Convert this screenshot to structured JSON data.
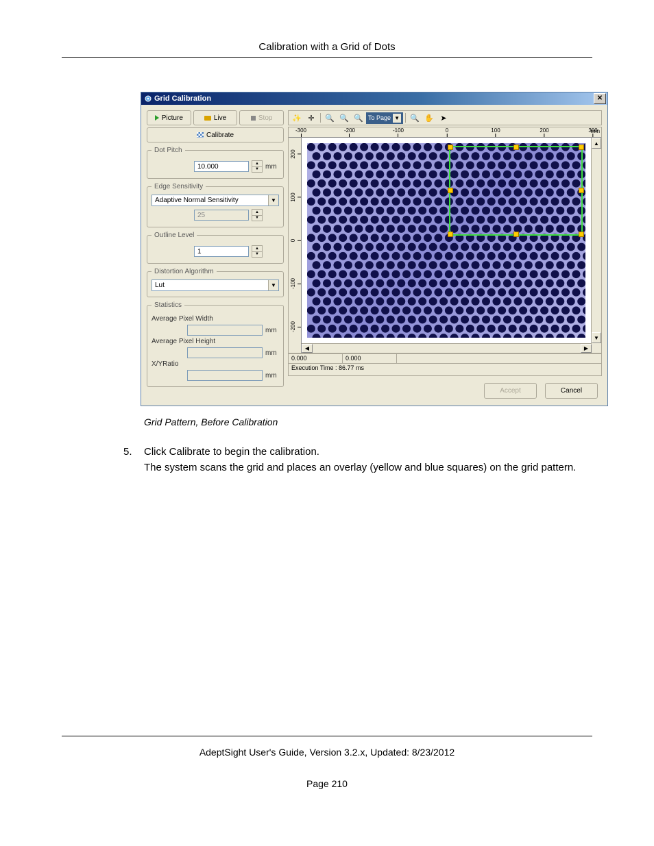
{
  "page": {
    "header": "Calibration with a Grid of Dots",
    "caption": "Grid Pattern, Before Calibration",
    "step_number": "5.",
    "step_text_1": "Click Calibrate to begin the calibration.",
    "step_text_2": "The system scans the grid and places an overlay (yellow and blue squares) on the grid pattern.",
    "footer": "AdeptSight User's Guide,  Version 3.2.x, Updated: 8/23/2012",
    "page_num": "Page 210"
  },
  "dialog": {
    "title": "Grid Calibration",
    "buttons": {
      "picture": "Picture",
      "live": "Live",
      "stop": "Stop",
      "calibrate": "Calibrate",
      "accept": "Accept",
      "cancel": "Cancel"
    },
    "groups": {
      "dot_pitch": {
        "legend": "Dot Pitch",
        "value": "10.000",
        "unit": "mm"
      },
      "edge": {
        "legend": "Edge Sensitivity",
        "mode": "Adaptive Normal Sensitivity",
        "value": "25"
      },
      "outline": {
        "legend": "Outline Level",
        "value": "1"
      },
      "distortion": {
        "legend": "Distortion Algorithm",
        "value": "Lut"
      },
      "stats": {
        "legend": "Statistics",
        "avg_w": "Average Pixel Width",
        "avg_h": "Average Pixel Height",
        "xy": "X/YRatio",
        "unit": "mm"
      }
    },
    "toolbar": {
      "topage": "To Page"
    },
    "ruler_h": [
      "-300",
      "-200",
      "-100",
      "0",
      "100",
      "200",
      "300"
    ],
    "ruler_h_unit": "mm",
    "ruler_v": [
      "200",
      "100",
      "0",
      "-100",
      "-200"
    ],
    "status": {
      "c1": "0.000",
      "c2": "0.000"
    },
    "exec": "Execution Time : 86.77 ms"
  }
}
